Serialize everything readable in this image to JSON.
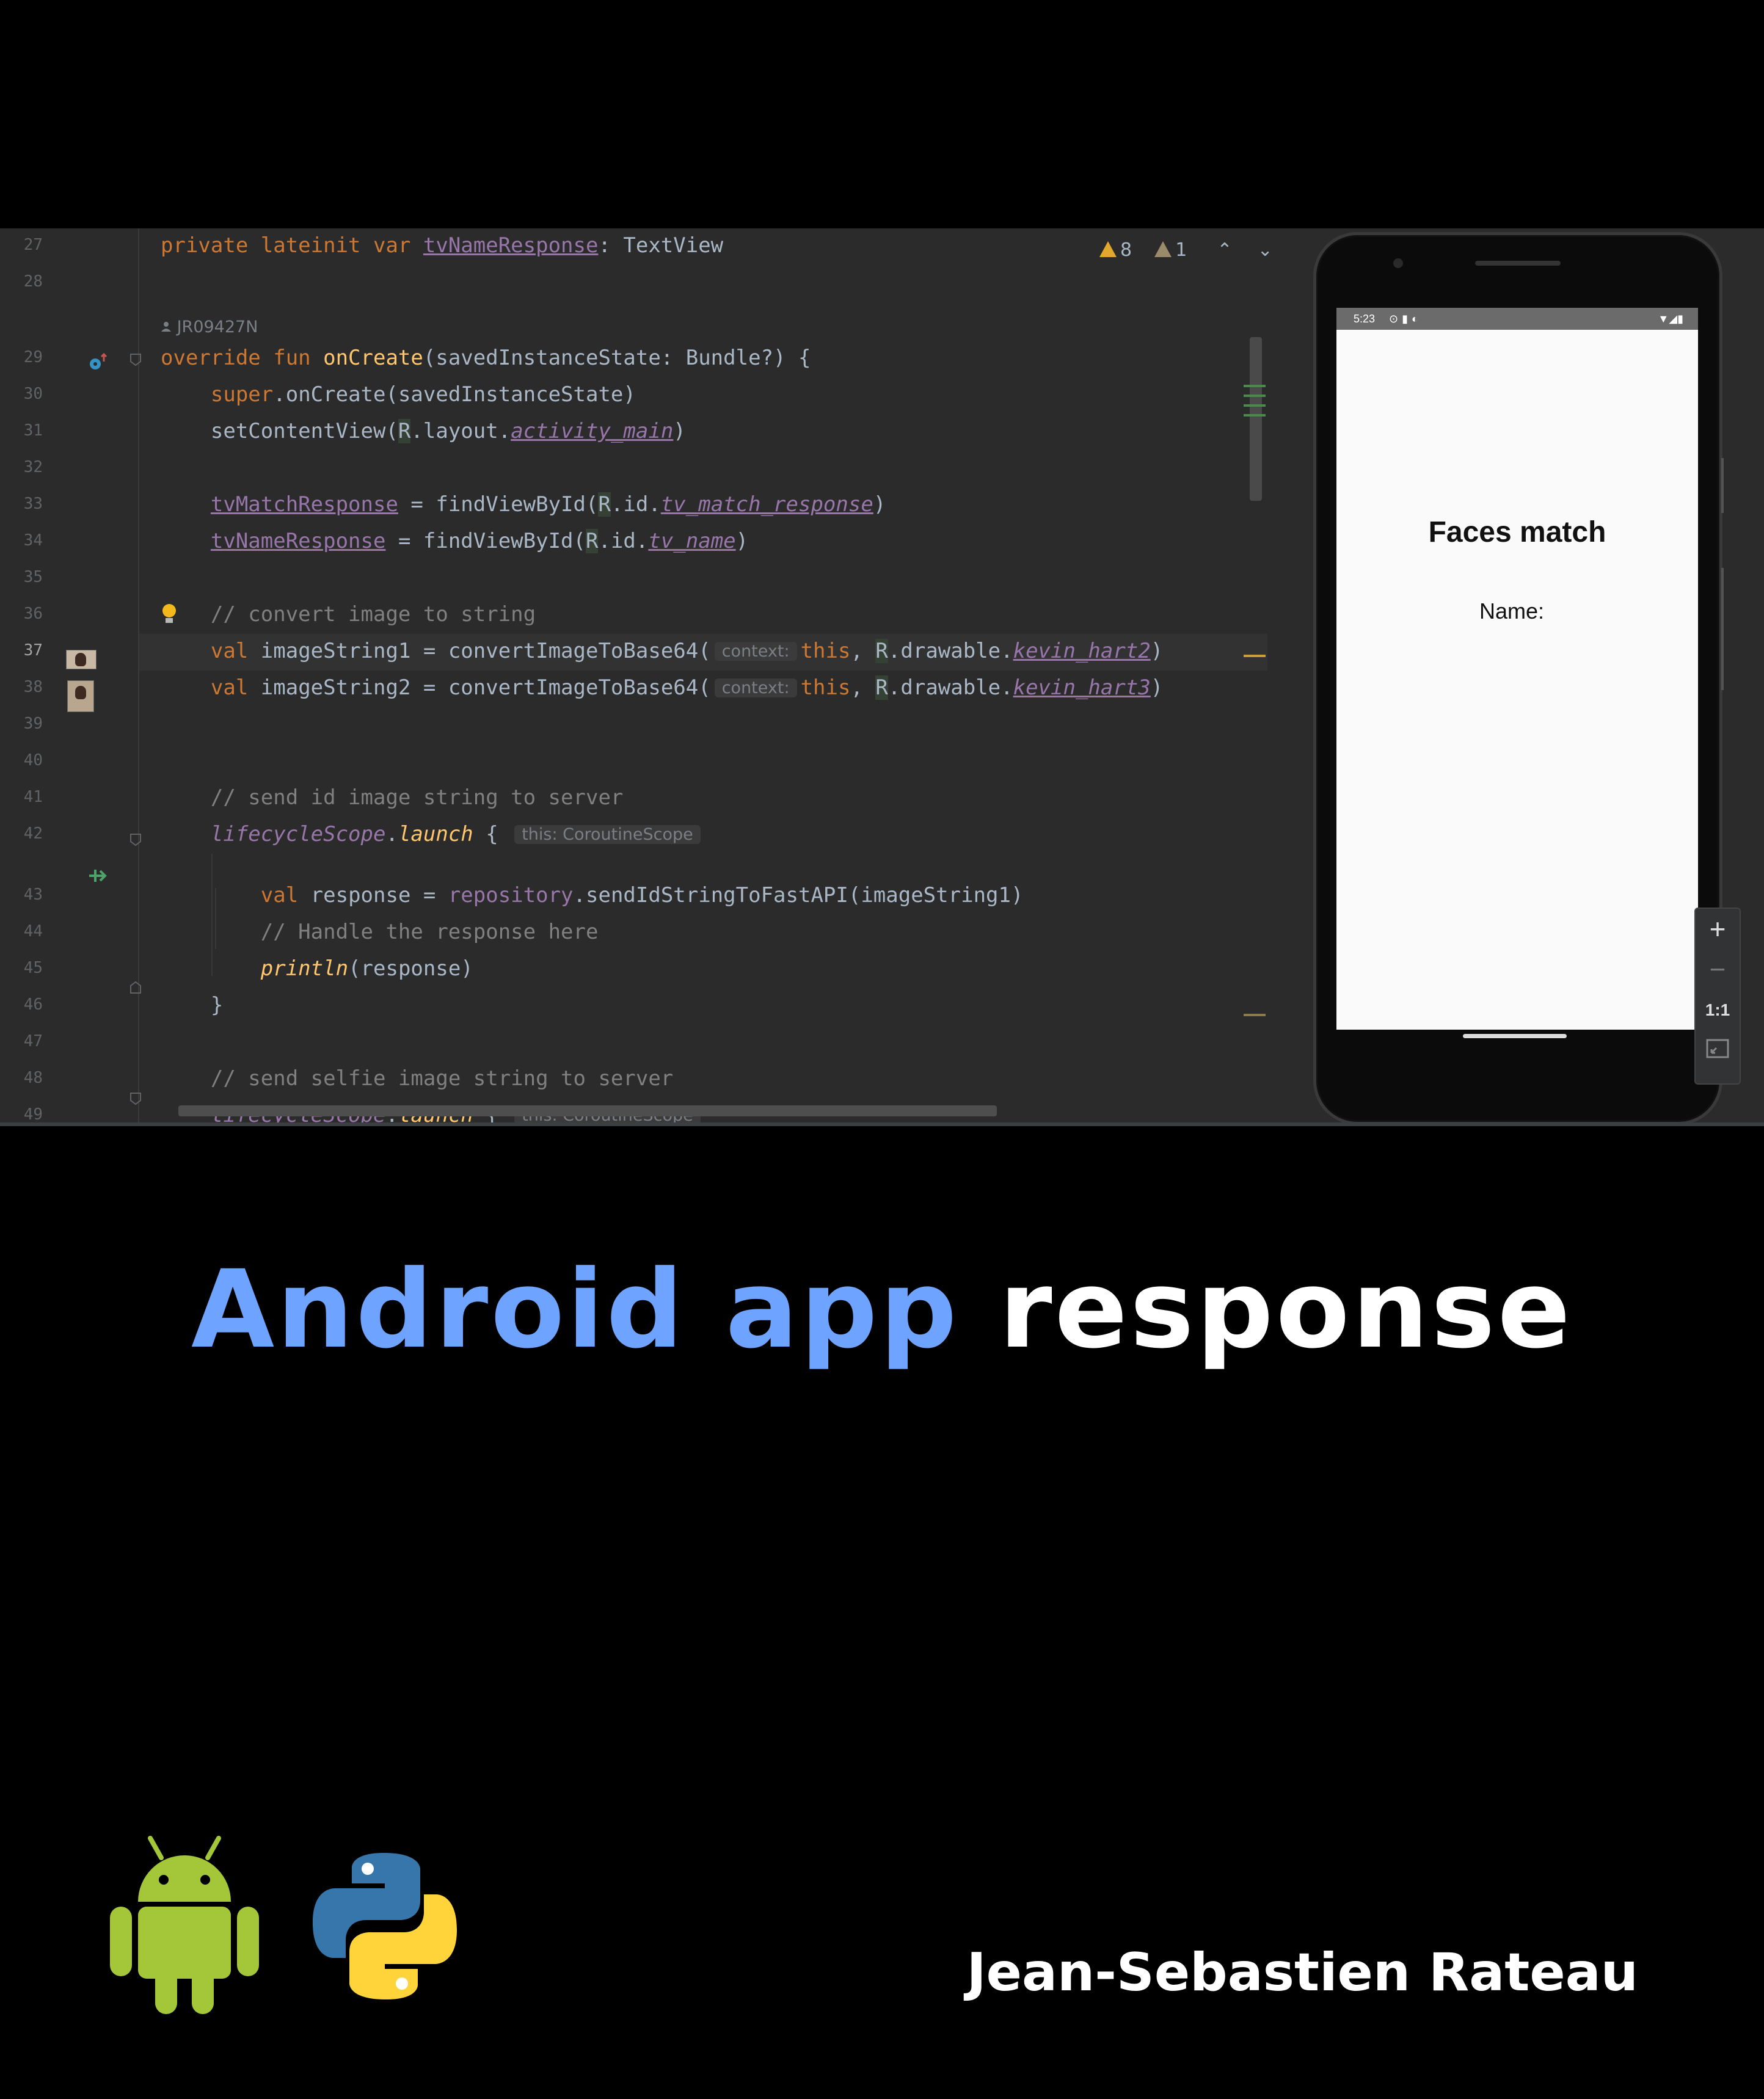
{
  "editor": {
    "lines": [
      {
        "num": "27",
        "text": "private lateinit var tvNameResponse: TextView"
      },
      {
        "num": "28",
        "text": ""
      },
      {
        "num": "29",
        "text": "override fun onCreate(savedInstanceState: Bundle?) {"
      },
      {
        "num": "30",
        "text": "super.onCreate(savedInstanceState)"
      },
      {
        "num": "31",
        "text": "setContentView(R.layout.activity_main)"
      },
      {
        "num": "32",
        "text": ""
      },
      {
        "num": "33",
        "text": "tvMatchResponse = findViewById(R.id.tv_match_response)"
      },
      {
        "num": "34",
        "text": "tvNameResponse = findViewById(R.id.tv_name)"
      },
      {
        "num": "35",
        "text": ""
      },
      {
        "num": "36",
        "text": "// convert image to string"
      },
      {
        "num": "37",
        "text": "val imageString1 = convertImageToBase64( context: this, R.drawable.kevin_hart2)"
      },
      {
        "num": "38",
        "text": "val imageString2 = convertImageToBase64( context: this, R.drawable.kevin_hart3)"
      },
      {
        "num": "39",
        "text": ""
      },
      {
        "num": "40",
        "text": ""
      },
      {
        "num": "41",
        "text": "// send id image string to server"
      },
      {
        "num": "42",
        "text": "lifecycleScope.launch { this: CoroutineScope"
      },
      {
        "num": "43",
        "text": "val response = repository.sendIdStringToFastAPI(imageString1)"
      },
      {
        "num": "44",
        "text": "// Handle the response here"
      },
      {
        "num": "45",
        "text": "println(response)"
      },
      {
        "num": "46",
        "text": "}"
      },
      {
        "num": "47",
        "text": ""
      },
      {
        "num": "48",
        "text": "// send selfie image string to server"
      },
      {
        "num": "49",
        "text": "lifecycleScope.launch { this: CoroutineScope"
      }
    ],
    "author": "JR09427N",
    "current_line": "37",
    "hint_context": "context:",
    "hint_scope": "this: CoroutineScope",
    "warnings": "8",
    "weak_warnings": "1"
  },
  "device": {
    "status_time": "5:23",
    "app_title": "Faces match",
    "name_label": "Name:",
    "zoom_plus": "+",
    "zoom_minus": "−",
    "zoom_reset": "1:1"
  },
  "caption": {
    "headline_blue": "Android app",
    "headline_white": "response",
    "author": "Jean-Sebastien Rateau"
  },
  "logos": [
    "android-logo",
    "python-logo"
  ],
  "colors": {
    "headline_blue": "#6ea4ff",
    "android_green": "#a4c639",
    "python_blue": "#3776ab",
    "python_yellow": "#ffd43b",
    "ide_background": "#2b2b2b",
    "keyword": "#cc7832",
    "function": "#ffc66d",
    "property": "#9876aa"
  }
}
